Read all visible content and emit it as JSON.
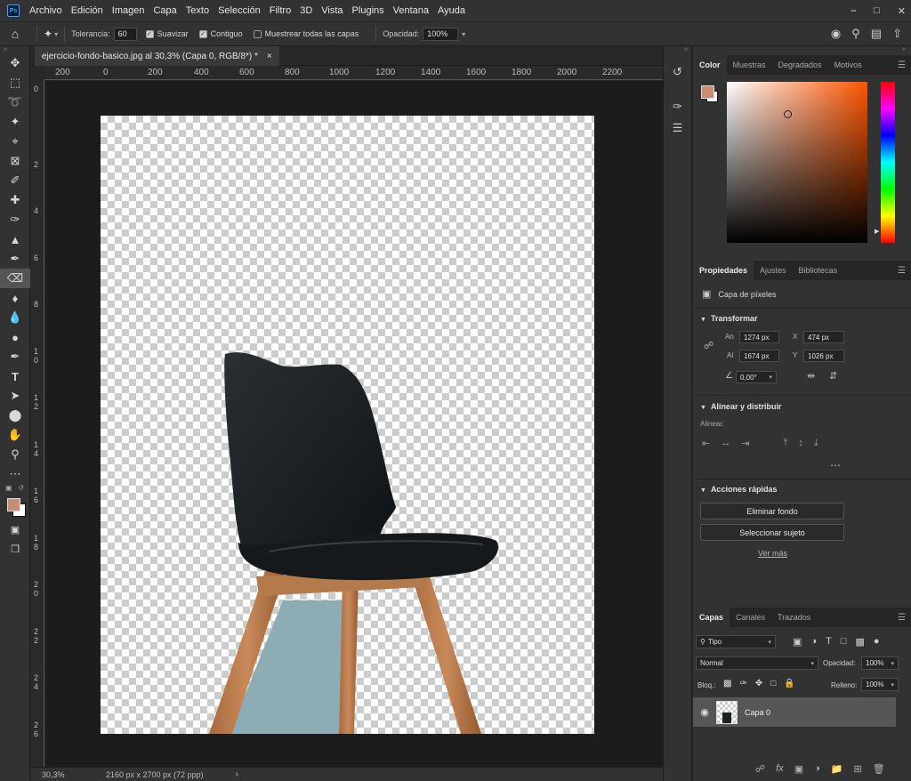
{
  "menu": [
    "Archivo",
    "Edición",
    "Imagen",
    "Capa",
    "Texto",
    "Selección",
    "Filtro",
    "3D",
    "Vista",
    "Plugins",
    "Ventana",
    "Ayuda"
  ],
  "app_logo": "Ps",
  "options": {
    "tolerance_label": "Tolerancia:",
    "tolerance_value": "60",
    "smooth_label": "Suavizar",
    "smooth_checked": true,
    "contiguous_label": "Contiguo",
    "contiguous_checked": true,
    "sample_all_label": "Muestrear todas las capas",
    "sample_all_checked": false,
    "opacity_label": "Opacidad:",
    "opacity_value": "100%"
  },
  "document": {
    "tab_title": "ejercicio-fondo-basico.jpg al 30,3% (Capa 0, RGB/8*) *",
    "close_glyph": "×"
  },
  "ruler_top": [
    "200",
    "0",
    "200",
    "400",
    "600",
    "800",
    "1000",
    "1200",
    "1400",
    "1600",
    "1800",
    "2000",
    "2200"
  ],
  "ruler_left": [
    "0",
    "2",
    "4",
    "6",
    "8",
    "1 0",
    "1 2",
    "1 4",
    "1 6",
    "1 8",
    "2 0",
    "2 2",
    "2 4",
    "2 6"
  ],
  "status": {
    "zoom": "30,3%",
    "doc_info": "2160 px x 2700 px (72 ppp)"
  },
  "color_panel": {
    "tabs": [
      "Color",
      "Muestras",
      "Degradados",
      "Motivos"
    ],
    "active_tab": "Color",
    "foreground_color": "#c98e72",
    "picker_hue": "#ff5400"
  },
  "properties_panel": {
    "tabs": [
      "Propiedades",
      "Ajustes",
      "Bibliotecas"
    ],
    "active_tab": "Propiedades",
    "layer_type": "Capa de píxeles",
    "transform_title": "Transformar",
    "w_label": "An",
    "w_value": "1274 px",
    "h_label": "Al",
    "h_value": "1674 px",
    "x_label": "X",
    "x_value": "474 px",
    "y_label": "Y",
    "y_value": "1026 px",
    "angle_value": "0,00°",
    "align_title": "Alinear y distribuir",
    "align_label": "Alinear:",
    "quick_actions_title": "Acciones rápidas",
    "remove_bg_label": "Eliminar fondo",
    "select_subject_label": "Seleccionar sujeto",
    "see_more_label": "Ver más"
  },
  "layers_panel": {
    "tabs": [
      "Capas",
      "Canales",
      "Trazados"
    ],
    "active_tab": "Capas",
    "filter_label": "Tipo",
    "blend_mode": "Normal",
    "opacity_label": "Opacidad:",
    "opacity_value": "100%",
    "lock_label": "Bloq.:",
    "fill_label": "Relleno:",
    "fill_value": "100%",
    "layers": [
      {
        "name": "Capa 0",
        "visible": true,
        "selected": true
      }
    ]
  }
}
